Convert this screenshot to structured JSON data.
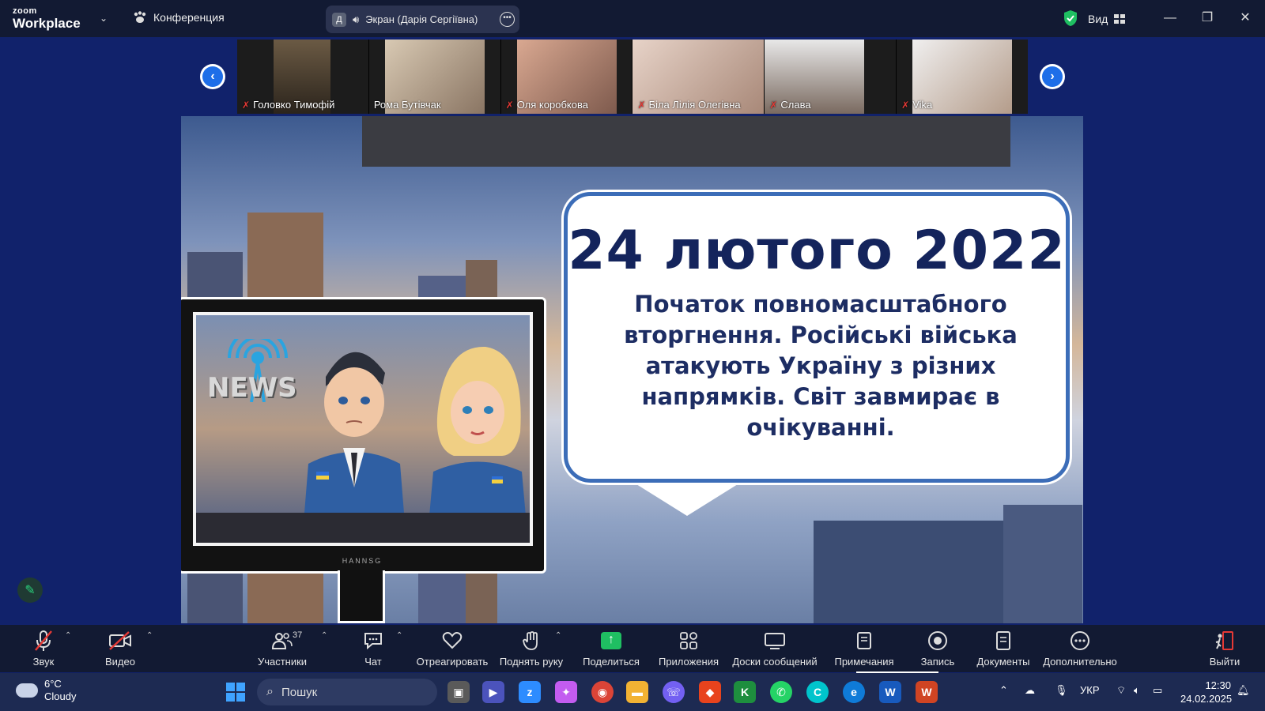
{
  "titlebar": {
    "brand_top": "zoom",
    "brand_bottom": "Workplace",
    "meeting_label": "Конференция",
    "share_avatar_letter": "Д",
    "share_label": "Экран (Дарія Сергіївна)",
    "view_label": "Вид"
  },
  "participants": [
    {
      "name": "Головко Тимофій",
      "muted": true
    },
    {
      "name": "Рома Бутівчак",
      "muted": false
    },
    {
      "name": "Оля коробкова",
      "muted": true
    },
    {
      "name": "Біла Лілія Олегівна",
      "muted": true
    },
    {
      "name": "Слава",
      "muted": true
    },
    {
      "name": "Vika",
      "muted": true
    }
  ],
  "slide": {
    "date": "24 лютого 2022",
    "description": "Початок повномасштабного вторгнення. Російські війська атакують Україну з різних напрямків. Світ завмирає в очікуванні.",
    "news_logo_text": "NEWS",
    "tv_brand": "HANNSG"
  },
  "toolbar": {
    "audio": "Звук",
    "video": "Видео",
    "participants": "Участники",
    "participants_count": "37",
    "chat": "Чат",
    "react": "Отреагировать",
    "raise_hand": "Поднять руку",
    "share": "Поделиться",
    "apps": "Приложения",
    "whiteboards": "Доски сообщений",
    "notes": "Примечания",
    "record": "Запись",
    "docs": "Документы",
    "more": "Дополнительно",
    "leave": "Выйти"
  },
  "taskbar": {
    "weather_temp": "6°C",
    "weather_desc": "Cloudy",
    "search_placeholder": "Пошук",
    "language": "УКР",
    "time": "12:30",
    "date": "24.02.2025"
  },
  "colors": {
    "accent_blue": "#1e6ee8",
    "muted_red": "#e53935",
    "share_green": "#1fbf62",
    "slide_text": "#14245c"
  }
}
